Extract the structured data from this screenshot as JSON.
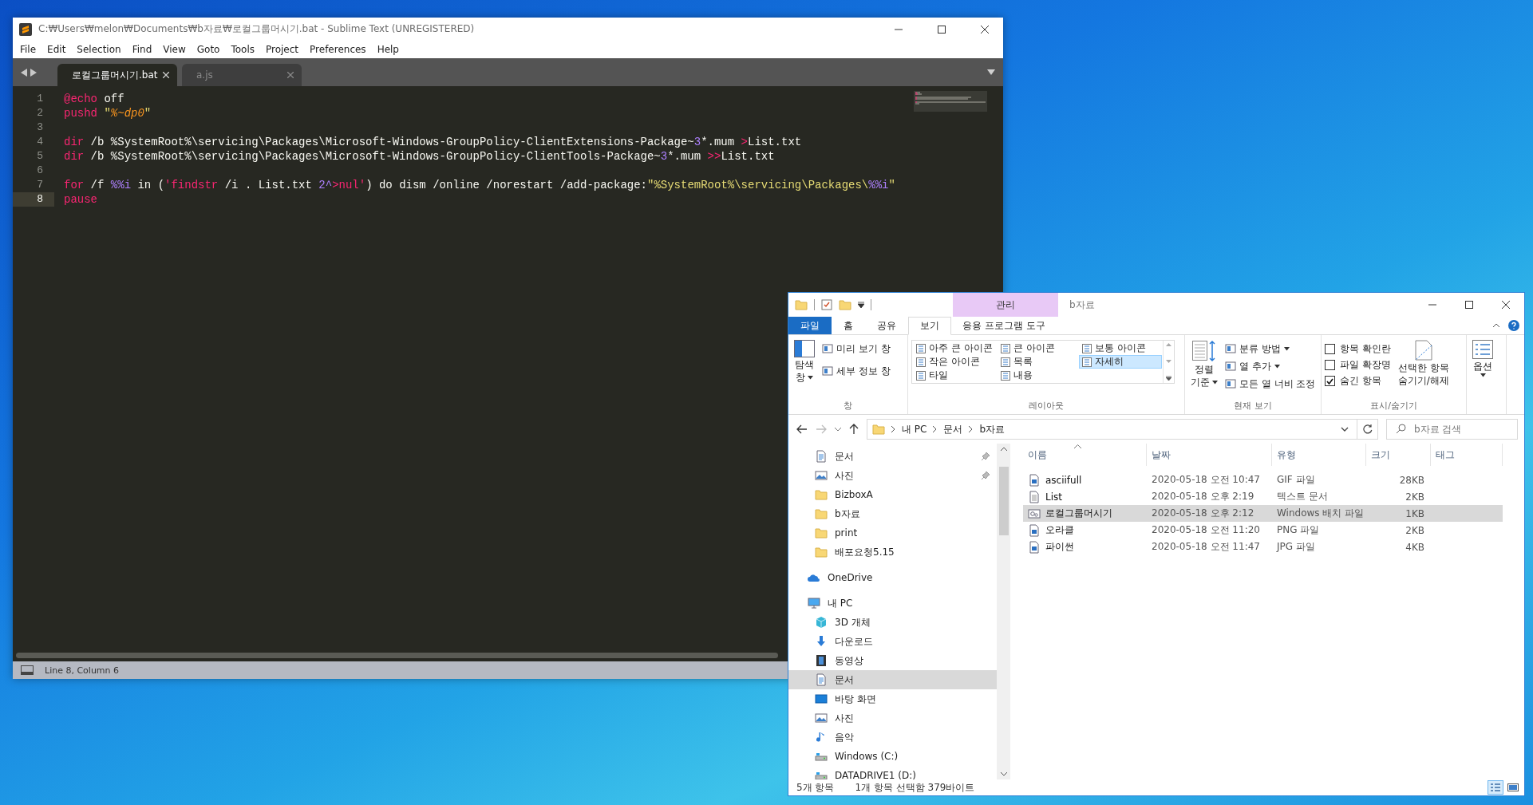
{
  "sublime": {
    "title": "C:₩Users₩melon₩Documents₩b자료₩로컬그룹머시기.bat - Sublime Text (UNREGISTERED)",
    "menu": [
      "File",
      "Edit",
      "Selection",
      "Find",
      "View",
      "Goto",
      "Tools",
      "Project",
      "Preferences",
      "Help"
    ],
    "tabs": [
      {
        "label": "로컬그룹머시기.bat",
        "selected": true
      },
      {
        "label": "a.js",
        "selected": false
      }
    ],
    "lines": [
      {
        "number": "1",
        "current": false,
        "tokens": [
          {
            "kind": "keyword",
            "text": "@echo"
          },
          {
            "kind": "plain",
            "text": " off"
          }
        ]
      },
      {
        "number": "2",
        "current": false,
        "tokens": [
          {
            "kind": "keyword",
            "text": "pushd "
          },
          {
            "kind": "string",
            "text": "\""
          },
          {
            "kind": "variable",
            "text": "%~dp0"
          },
          {
            "kind": "string",
            "text": "\""
          }
        ]
      },
      {
        "number": "3",
        "current": false
      },
      {
        "number": "4",
        "current": false,
        "tokens": [
          {
            "kind": "keyword",
            "text": "dir"
          },
          {
            "kind": "plain",
            "text": " /b %SystemRoot%\\servicing\\Packages\\Microsoft-Windows-GroupPolicy-ClientExtensions-Package~"
          },
          {
            "kind": "number",
            "text": "3"
          },
          {
            "kind": "plain",
            "text": "*.mum "
          },
          {
            "kind": "keyword",
            "text": ">"
          },
          {
            "kind": "plain",
            "text": "List.txt"
          }
        ]
      },
      {
        "number": "5",
        "current": false,
        "tokens": [
          {
            "kind": "keyword",
            "text": "dir"
          },
          {
            "kind": "plain",
            "text": " /b %SystemRoot%\\servicing\\Packages\\Microsoft-Windows-GroupPolicy-ClientTools-Package~"
          },
          {
            "kind": "number",
            "text": "3"
          },
          {
            "kind": "plain",
            "text": "*.mum "
          },
          {
            "kind": "keyword",
            "text": ">>"
          },
          {
            "kind": "plain",
            "text": "List.txt"
          }
        ]
      },
      {
        "number": "6",
        "current": false
      },
      {
        "number": "7",
        "current": false,
        "tokens": [
          {
            "kind": "keyword",
            "text": "for"
          },
          {
            "kind": "plain",
            "text": " /f "
          },
          {
            "kind": "number",
            "text": "%%i"
          },
          {
            "kind": "plain",
            "text": " in ("
          },
          {
            "kind": "keyword",
            "text": "'findstr"
          },
          {
            "kind": "plain",
            "text": " /i . List.txt "
          },
          {
            "kind": "number",
            "text": "2^"
          },
          {
            "kind": "keyword",
            "text": ">nul'"
          },
          {
            "kind": "plain",
            "text": ") do dism /online /norestart /add-package:"
          },
          {
            "kind": "string",
            "text": "\"%SystemRoot%\\servicing\\Packages\\"
          },
          {
            "kind": "number",
            "text": "%%i"
          },
          {
            "kind": "string",
            "text": "\""
          }
        ]
      },
      {
        "number": "8",
        "current": true,
        "tokens": [
          {
            "kind": "keyword",
            "text": "pause"
          }
        ]
      }
    ],
    "status": "Line 8, Column 6"
  },
  "explorer": {
    "contextual_header": "관리",
    "title": "b자료",
    "tabs": [
      {
        "label": "파일",
        "kind": "file",
        "selected": false
      },
      {
        "label": "홈",
        "kind": "normal",
        "selected": false
      },
      {
        "label": "공유",
        "kind": "normal",
        "selected": false
      },
      {
        "label": "보기",
        "kind": "normal",
        "selected": true
      },
      {
        "label": "응용 프로그램 도구",
        "kind": "normal",
        "selected": false
      }
    ],
    "ribbon": {
      "panes": {
        "label": "창",
        "big": [
          "탐색",
          "창"
        ],
        "items": [
          "미리 보기 창",
          "세부 정보 창"
        ]
      },
      "layout": {
        "label": "레이아웃",
        "items": [
          {
            "label": "아주 큰 아이콘",
            "selected": false
          },
          {
            "label": "큰 아이콘",
            "selected": false
          },
          {
            "label": "보통 아이콘",
            "selected": false
          },
          {
            "label": "작은 아이콘",
            "selected": false
          },
          {
            "label": "목록",
            "selected": false
          },
          {
            "label": "자세히",
            "selected": true
          },
          {
            "label": "타일",
            "selected": false
          },
          {
            "label": "내용",
            "selected": false
          }
        ]
      },
      "current_view": {
        "label": "현재 보기",
        "big": [
          "정렬",
          "기준"
        ],
        "items": [
          {
            "label": "분류 방법",
            "dropdown": true
          },
          {
            "label": "열 추가",
            "dropdown": true
          },
          {
            "label": "모든 열 너비 조정",
            "dropdown": false
          }
        ]
      },
      "show_hide": {
        "label": "표시/숨기기",
        "checks": [
          {
            "label": "항목 확인란",
            "checked": false
          },
          {
            "label": "파일 확장명",
            "checked": false
          },
          {
            "label": "숨긴 항목",
            "checked": true
          }
        ],
        "big": [
          "선택한 항목",
          "숨기기/해제"
        ]
      },
      "options": {
        "big": [
          "옵션"
        ]
      }
    },
    "address": {
      "crumbs": [
        "내 PC",
        "문서",
        "b자료"
      ],
      "search_placeholder": "b자료 검색"
    },
    "quick_access": [
      {
        "label": "문서",
        "kind": "document",
        "pinned": true,
        "selected": false
      },
      {
        "label": "사진",
        "kind": "picture",
        "pinned": true,
        "selected": false
      },
      {
        "label": "BizboxA",
        "kind": "folder",
        "pinned": false,
        "selected": false
      },
      {
        "label": "b자료",
        "kind": "folder",
        "pinned": false,
        "selected": false
      },
      {
        "label": "print",
        "kind": "folder",
        "pinned": false,
        "selected": false
      },
      {
        "label": "배포요청5.15",
        "kind": "folder",
        "pinned": false,
        "selected": false
      }
    ],
    "tree": [
      {
        "label": "OneDrive",
        "kind": "cloud",
        "selected": false
      },
      {
        "label": "내 PC",
        "kind": "computer",
        "selected": false,
        "children": [
          {
            "label": "3D 개체",
            "kind": "cube",
            "selected": false
          },
          {
            "label": "다운로드",
            "kind": "download",
            "selected": false
          },
          {
            "label": "동영상",
            "kind": "video",
            "selected": false
          },
          {
            "label": "문서",
            "kind": "document",
            "selected": true
          },
          {
            "label": "바탕 화면",
            "kind": "desktop",
            "selected": false
          },
          {
            "label": "사진",
            "kind": "picture",
            "selected": false
          },
          {
            "label": "음악",
            "kind": "music",
            "selected": false
          },
          {
            "label": "Windows (C:)",
            "kind": "drive",
            "selected": false
          },
          {
            "label": "DATADRIVE1 (D:)",
            "kind": "drive",
            "selected": false
          }
        ]
      }
    ],
    "columns": [
      {
        "label": "이름",
        "sorted": true
      },
      {
        "label": "날짜",
        "sorted": false
      },
      {
        "label": "유형",
        "sorted": false
      },
      {
        "label": "크기",
        "sorted": false
      },
      {
        "label": "태그",
        "sorted": false
      }
    ],
    "files": [
      {
        "kind": "image",
        "selected": false,
        "cells": [
          "asciifull",
          "2020-05-18 오전 10:47",
          "GIF 파일",
          "28KB"
        ]
      },
      {
        "kind": "text",
        "selected": false,
        "cells": [
          "List",
          "2020-05-18 오후 2:19",
          "텍스트 문서",
          "2KB"
        ]
      },
      {
        "kind": "batch",
        "selected": true,
        "cells": [
          "로컬그룹머시기",
          "2020-05-18 오후 2:12",
          "Windows 배치 파일",
          "1KB"
        ]
      },
      {
        "kind": "image",
        "selected": false,
        "cells": [
          "오라클",
          "2020-05-18 오전 11:20",
          "PNG 파일",
          "2KB"
        ]
      },
      {
        "kind": "image",
        "selected": false,
        "cells": [
          "파이썬",
          "2020-05-18 오전 11:47",
          "JPG 파일",
          "4KB"
        ]
      }
    ],
    "status": {
      "count": "5개 항목",
      "selection": "1개 항목 선택함 379바이트"
    },
    "views": [
      {
        "kind": "details",
        "selected": true
      },
      {
        "kind": "large_icons",
        "selected": false
      }
    ]
  }
}
